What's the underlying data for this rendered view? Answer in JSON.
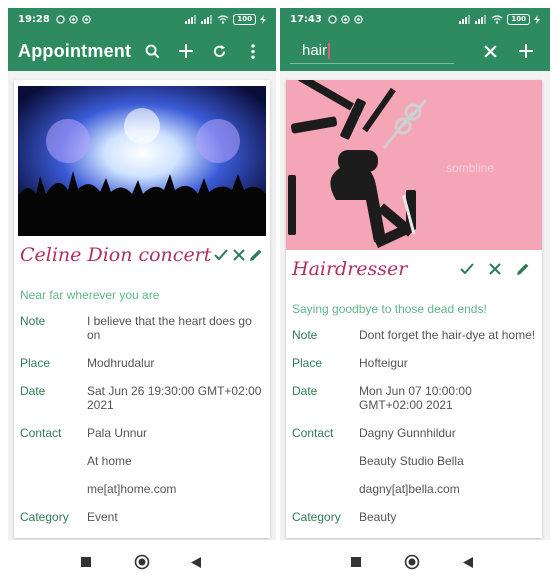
{
  "left": {
    "status": {
      "time": "19:28",
      "battery": "100"
    },
    "appbar": {
      "title": "Appointment"
    },
    "card": {
      "title": "Celine Dion concert",
      "subtitle": "Near far wherever you are",
      "rows": [
        {
          "label": "Note",
          "value": "I believe that the heart does go on"
        },
        {
          "label": "Place",
          "value": "Modhrudalur"
        },
        {
          "label": "Date",
          "value": "Sat Jun 26 19:30:00 GMT+02:00 2021"
        },
        {
          "label": "Contact",
          "value": "Pala Unnur"
        },
        {
          "label": "",
          "value": "At home"
        },
        {
          "label": "",
          "value": "me[at]home.com"
        },
        {
          "label": "Category",
          "value": "Event"
        }
      ]
    }
  },
  "right": {
    "status": {
      "time": "17:43",
      "battery": "100"
    },
    "search": {
      "value": "hair"
    },
    "card": {
      "title": "Hairdresser",
      "subtitle": "Saying goodbye to those dead ends!",
      "rows": [
        {
          "label": "Note",
          "value": "Dont forget the hair-dye at home!"
        },
        {
          "label": "Place",
          "value": "Hofteigur"
        },
        {
          "label": "Date",
          "value": "Mon Jun 07 10:00:00 GMT+02:00 2021"
        },
        {
          "label": "Contact",
          "value": "Dagny Gunnhildur"
        },
        {
          "label": "",
          "value": "Beauty Studio Bella"
        },
        {
          "label": "",
          "value": "dagny[at]bella.com"
        },
        {
          "label": "Category",
          "value": "Beauty"
        }
      ]
    }
  },
  "icons": {
    "search": "search-icon",
    "add": "plus-icon",
    "refresh": "refresh-icon",
    "menu": "more-vert-icon",
    "close": "close-icon",
    "check": "check-icon",
    "delete": "close-icon",
    "edit": "pencil-icon"
  },
  "colors": {
    "primary": "#2e8b5f",
    "title": "#b03060",
    "label": "#2e7d57",
    "subtitle": "#5fb58b",
    "photo_bg": "#f4a6b7"
  }
}
